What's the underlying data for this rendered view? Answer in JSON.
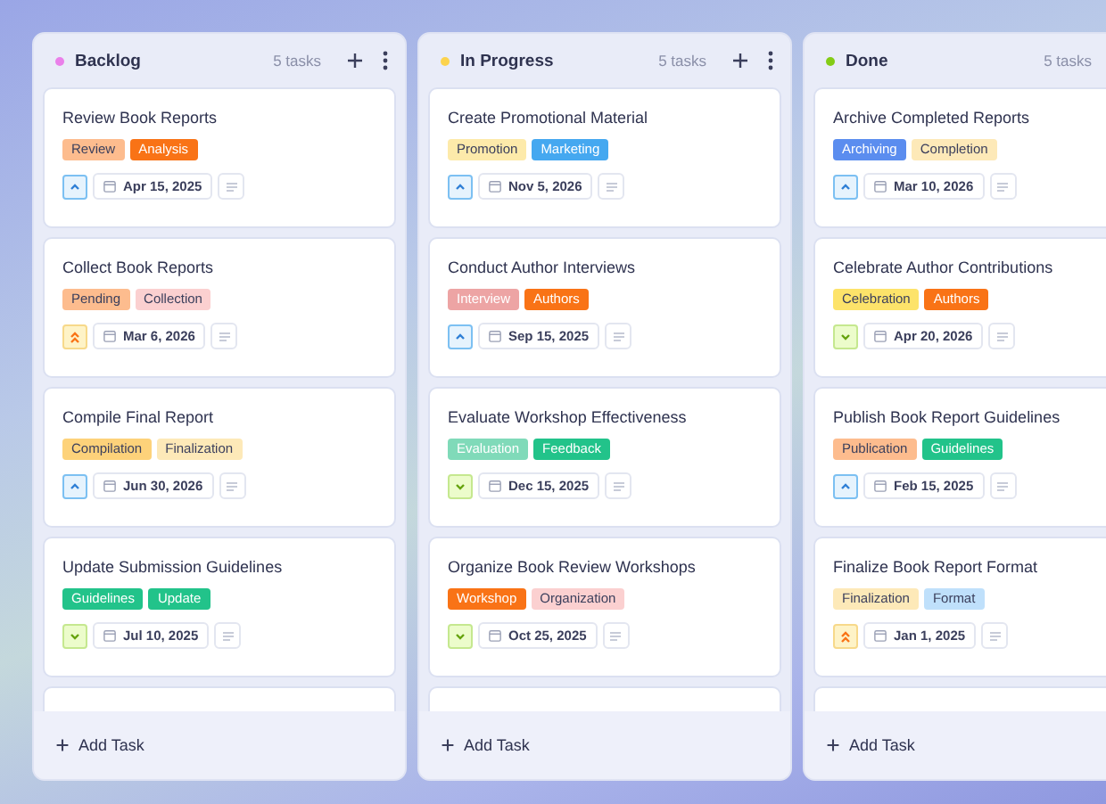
{
  "columns": [
    {
      "title": "Backlog",
      "color": "#ea80ea",
      "count": "5 tasks",
      "add_label": "Add Task",
      "cards": [
        {
          "title": "Review Book Reports",
          "kind": "medium",
          "date": "Apr 15, 2025",
          "tags": [
            {
              "label": "Review",
              "color": "#fdbc8e"
            },
            {
              "label": "Analysis",
              "color": "#f97316"
            }
          ]
        },
        {
          "title": "Collect Book Reports",
          "kind": "high",
          "date": "Mar 6, 2026",
          "tags": [
            {
              "label": "Pending",
              "color": "#fdbc8e"
            },
            {
              "label": "Collection",
              "color": "#fbd0d0"
            }
          ]
        },
        {
          "title": "Compile Final Report",
          "kind": "medium",
          "date": "Jun 30, 2026",
          "tags": [
            {
              "label": "Compilation",
              "color": "#fdd27a"
            },
            {
              "label": "Finalization",
              "color": "#fde9b8"
            }
          ]
        },
        {
          "title": "Update Submission Guidelines",
          "kind": "low",
          "date": "Jul 10, 2025",
          "tags": [
            {
              "label": "Guidelines",
              "color": "#22c38a"
            },
            {
              "label": "Update",
              "color": "#22c38a"
            }
          ]
        }
      ]
    },
    {
      "title": "In Progress",
      "color": "#fcd34d",
      "count": "5 tasks",
      "add_label": "Add Task",
      "cards": [
        {
          "title": "Create Promotional Material",
          "kind": "medium",
          "date": "Nov 5, 2026",
          "tags": [
            {
              "label": "Promotion",
              "color": "#fdeaaa"
            },
            {
              "label": "Marketing",
              "color": "#45a8f0"
            }
          ]
        },
        {
          "title": "Conduct Author Interviews",
          "kind": "medium",
          "date": "Sep 15, 2025",
          "tags": [
            {
              "label": "Interview",
              "color": "#eda4a4"
            },
            {
              "label": "Authors",
              "color": "#f97316"
            }
          ]
        },
        {
          "title": "Evaluate Workshop Effectiveness",
          "kind": "low",
          "date": "Dec 15, 2025",
          "tags": [
            {
              "label": "Evaluation",
              "color": "#80dab9"
            },
            {
              "label": "Feedback",
              "color": "#22c38a"
            }
          ]
        },
        {
          "title": "Organize Book Review Workshops",
          "kind": "low",
          "date": "Oct 25, 2025",
          "tags": [
            {
              "label": "Workshop",
              "color": "#f97316"
            },
            {
              "label": "Organization",
              "color": "#fbd0d0"
            }
          ]
        }
      ]
    },
    {
      "title": "Done",
      "color": "#84cc16",
      "count": "5 tasks",
      "add_label": "Add Task",
      "cards": [
        {
          "title": "Archive Completed Reports",
          "kind": "medium",
          "date": "Mar 10, 2026",
          "tags": [
            {
              "label": "Archiving",
              "color": "#5b8def"
            },
            {
              "label": "Completion",
              "color": "#fde9b8"
            }
          ]
        },
        {
          "title": "Celebrate Author Contributions",
          "kind": "low",
          "date": "Apr 20, 2026",
          "tags": [
            {
              "label": "Celebration",
              "color": "#fde36a"
            },
            {
              "label": "Authors",
              "color": "#f97316"
            }
          ]
        },
        {
          "title": "Publish Book Report Guidelines",
          "kind": "medium",
          "date": "Feb 15, 2025",
          "tags": [
            {
              "label": "Publication",
              "color": "#fdbc8e"
            },
            {
              "label": "Guidelines",
              "color": "#22c38a"
            }
          ]
        },
        {
          "title": "Finalize Book Report Format",
          "kind": "high",
          "date": "Jan 1, 2025",
          "tags": [
            {
              "label": "Finalization",
              "color": "#fde9b8"
            },
            {
              "label": "Format",
              "color": "#bfe0fb"
            }
          ]
        }
      ]
    }
  ]
}
